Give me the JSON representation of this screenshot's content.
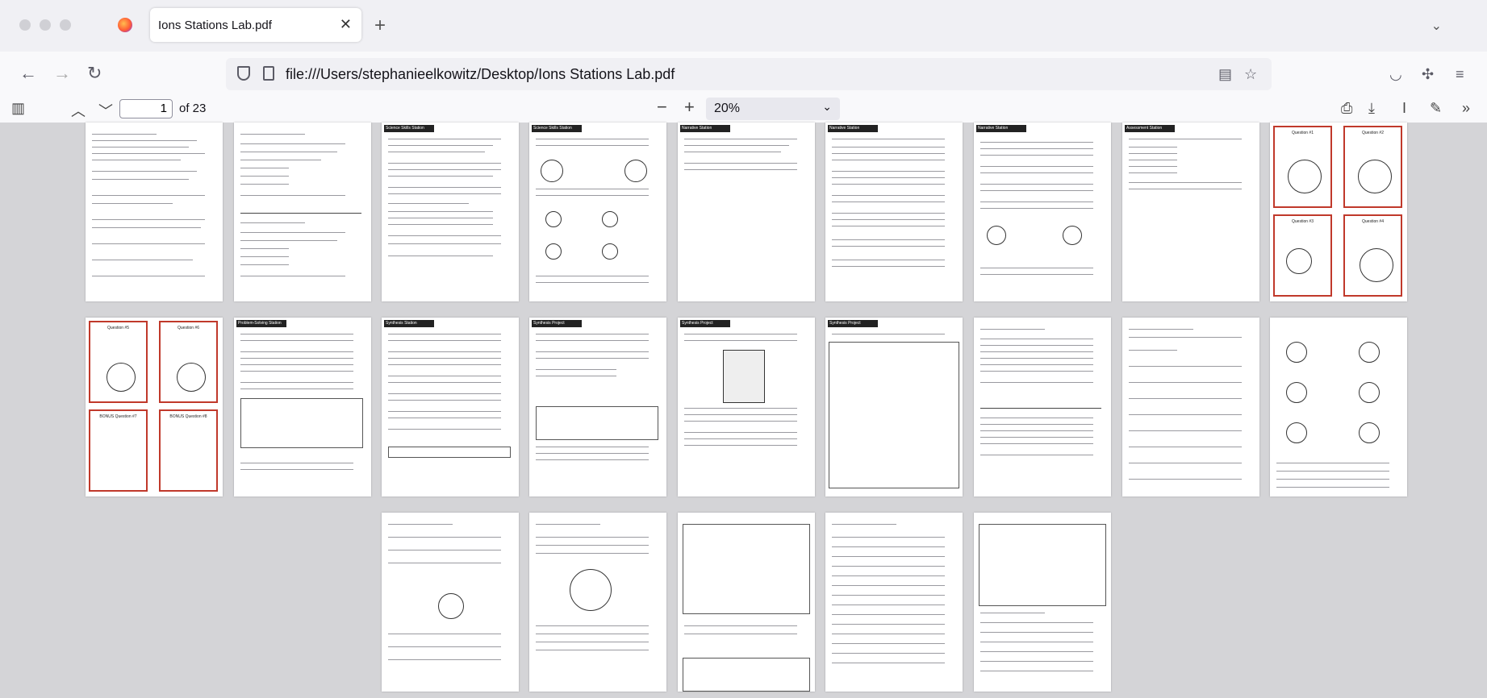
{
  "browser": {
    "tab_title": "Ions Stations Lab.pdf",
    "url": "file:///Users/stephanieelkowitz/Desktop/Ions Stations Lab.pdf"
  },
  "pdf_toolbar": {
    "current_page": "1",
    "total_pages_label": "of 23",
    "zoom": "20%"
  },
  "thumbnails": {
    "row1": [
      "",
      "",
      "Science Skills Station",
      "Science Skills Station",
      "Narrative Station",
      "Narrative Station",
      "Narrative Station",
      "Assessment Station",
      ""
    ],
    "row2": [
      "",
      "Problem-Solving Station",
      "Synthesis Station",
      "Synthesis Project",
      "Synthesis Project",
      "Synthesis Project",
      "",
      "",
      ""
    ],
    "row3": [
      "",
      "",
      "",
      "",
      "",
      ""
    ]
  },
  "cards": {
    "page9": [
      "Question #1",
      "Question #2",
      "Question #3",
      "Question #4"
    ],
    "page10": [
      "Question #5",
      "Question #6",
      "BONUS Question #7",
      "BONUS Question #8"
    ]
  },
  "colors": {
    "accent_red": "#c0392b",
    "header_black": "#222222"
  }
}
